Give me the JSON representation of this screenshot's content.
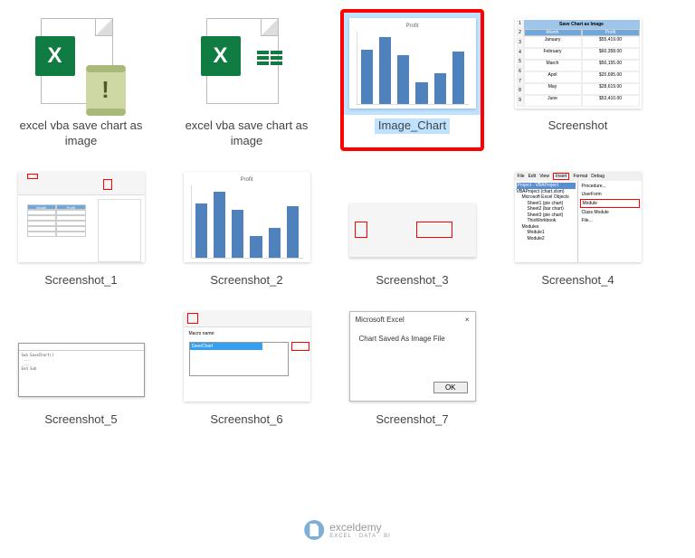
{
  "files": [
    {
      "label": "excel vba save chart as image"
    },
    {
      "label": "excel vba save chart as image"
    },
    {
      "label": "Image_Chart"
    },
    {
      "label": "Screenshot"
    },
    {
      "label": "Screenshot_1"
    },
    {
      "label": "Screenshot_2"
    },
    {
      "label": "Screenshot_3"
    },
    {
      "label": "Screenshot_4"
    },
    {
      "label": "Screenshot_5"
    },
    {
      "label": "Screenshot_6"
    },
    {
      "label": "Screenshot_7"
    }
  ],
  "chart_data": {
    "type": "bar",
    "title": "Profit",
    "categories": [
      "January",
      "February",
      "March",
      "April",
      "May",
      "June"
    ],
    "values": [
      55419,
      60358,
      50155,
      20695,
      28619,
      53410
    ]
  },
  "table_preview": {
    "title": "Save Chart as Image",
    "headers": [
      "Month",
      "Profit"
    ],
    "rows": [
      [
        "January",
        "$55,419.00"
      ],
      [
        "February",
        "$60,358.00"
      ],
      [
        "March",
        "$50,155.00"
      ],
      [
        "April",
        "$20,695.00"
      ],
      [
        "May",
        "$28,619.00"
      ],
      [
        "June",
        "$53,410.00"
      ]
    ]
  },
  "dialog": {
    "title": "Microsoft Excel",
    "close": "×",
    "message": "Chart Saved As Image File",
    "ok": "OK"
  },
  "vbe": {
    "menus": [
      "File",
      "Edit",
      "View",
      "Insert",
      "Format",
      "Debug"
    ],
    "submenu": [
      "Procedure...",
      "UserForm",
      "Module",
      "Class Module",
      "File..."
    ],
    "project_header": "Project - VBAProject",
    "tree": [
      "VBAProject (chart.xlsm)",
      " Microsoft Excel Objects",
      "  Sheet1 (pie chart)",
      "  Sheet2 (bar chart)",
      "  Sheet3 (pie chart)",
      "  ThisWorkbook",
      " Modules",
      "  Module1",
      "  Module2"
    ]
  },
  "watermark": {
    "brand": "exceldemy",
    "tagline": "EXCEL · DATA · BI"
  }
}
